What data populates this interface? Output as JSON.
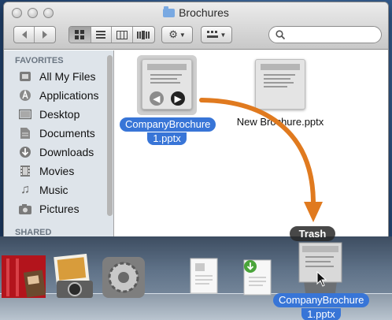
{
  "window": {
    "title": "Brochures"
  },
  "toolbar": {
    "back_icon": "chevron-left-icon",
    "forward_icon": "chevron-right-icon",
    "view_modes": [
      "icon-view-icon",
      "list-view-icon",
      "column-view-icon",
      "coverflow-view-icon"
    ],
    "action_icon": "gear-icon",
    "arrange_icon": "arrange-grid-icon",
    "search_value": ""
  },
  "sidebar": {
    "favorites_heading": "FAVORITES",
    "items": [
      {
        "label": "All My Files",
        "icon": "all-files-icon"
      },
      {
        "label": "Applications",
        "icon": "applications-icon"
      },
      {
        "label": "Desktop",
        "icon": "desktop-icon"
      },
      {
        "label": "Documents",
        "icon": "documents-icon"
      },
      {
        "label": "Downloads",
        "icon": "downloads-icon"
      },
      {
        "label": "Movies",
        "icon": "movies-icon"
      },
      {
        "label": "Music",
        "icon": "music-icon"
      },
      {
        "label": "Pictures",
        "icon": "pictures-icon"
      }
    ],
    "shared_heading": "SHARED"
  },
  "files": [
    {
      "name_line1": "CompanyBrochure",
      "name_line2": "1.pptx",
      "selected": true
    },
    {
      "name": "New Brochure.pptx",
      "selected": false
    }
  ],
  "dock": {
    "trash_tooltip": "Trash",
    "dragged_line1": "CompanyBrochure",
    "dragged_line2": "1.pptx"
  },
  "colors": {
    "selection": "#3875d7",
    "arrow": "#e07a1f"
  }
}
